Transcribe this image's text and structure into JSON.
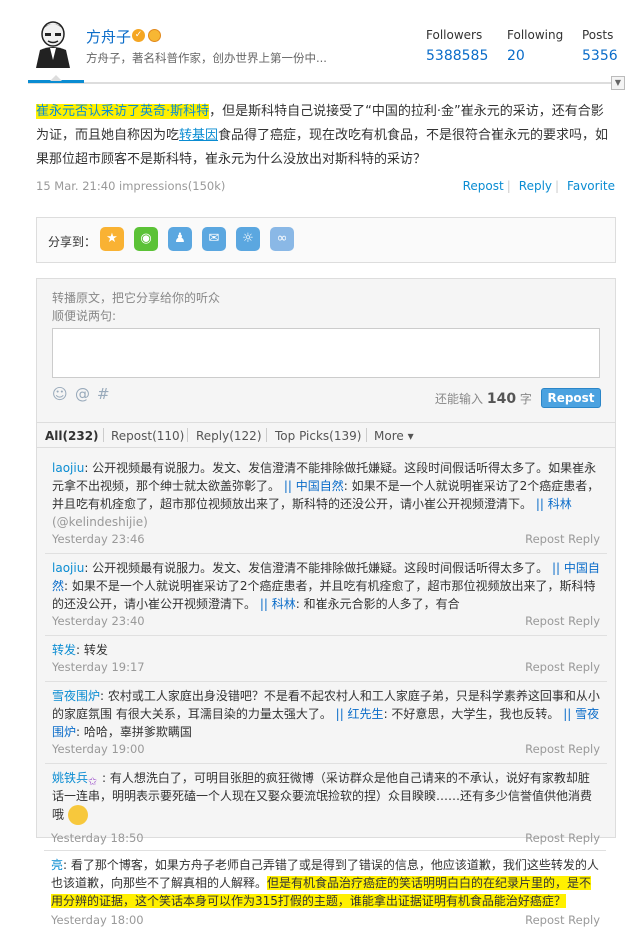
{
  "header": {
    "username": "方舟子",
    "bio": "方舟子，著名科普作家，创办世界上第一份中...",
    "followers_label": "Followers",
    "followers_value": "5388585",
    "following_label": "Following",
    "following_value": "20",
    "posts_label": "Posts",
    "posts_value": "5356"
  },
  "post": {
    "part1": "崔永元否认采访了英奇·斯科特",
    "part2": "，但是斯科特自己说接受了“中国的拉利·金”崔永元的采访，还有合影为证，而且她自称因为吃",
    "link": "转基因",
    "part3": "食品得了癌症，现在改吃有机食品，不是很符合崔永元的要求吗，如果那位超市顾客不是斯科特，崔永元为什么没放出对斯科特的采访？",
    "meta": "15 Mar. 21:40 impressions(150k)",
    "repost": "Repost",
    "reply": "Reply",
    "favorite": "Favorite"
  },
  "share": {
    "label": "分享到："
  },
  "repost_box": {
    "hint1": "转播原文，把它分享给你的听众",
    "hint2": "顺便说两句:",
    "count_prefix": "还能输入",
    "count_value": "140",
    "count_suffix": "字",
    "button": "Repost"
  },
  "tabs": {
    "all": "All(232)",
    "repost": "Repost(110)",
    "reply": "Reply(122)",
    "top": "Top Picks(139)",
    "more": "More"
  },
  "comments": [
    {
      "t1": "laojiu",
      "t2": ": 公开视频最有说服力。发文、发信澄清不能排除做托嫌疑。这段时间假话听得太多了。如果崔永元拿不出视频，那个绅士就太欲盖弥彰了。",
      "t3": "|| 中国自然",
      "t4": ": 如果不是一个人就说明崔采访了2个癌症患者，并且吃有机痊愈了，超市那位视频放出来了，斯科特的还没公开，请小崔公开视频澄清下。",
      "t5": "|| 科林",
      "t6": "(@kelindeshijie)",
      "time": "Yesterday 23:46",
      "action": "Repost Reply"
    },
    {
      "t1": "laojiu",
      "t2": ": 公开视频最有说服力。发文、发信澄清不能排除做托嫌疑。这段时间假话听得太多了。",
      "t3": "|| 中国自然",
      "t4": ": 如果不是一个人就说明崔采访了2个癌症患者，并且吃有机痊愈了，超市那位视频放出来了，斯科特的还没公开，请小崔公开视频澄清下。",
      "t5": "|| 科林",
      "t6": ": 和崔永元合影的人多了，有合",
      "time": "Yesterday 23:40",
      "action": "Repost Reply"
    },
    {
      "t1": "转发",
      "t2": ": 转发",
      "time": "Yesterday 19:17",
      "action": "Repost Reply"
    },
    {
      "t1": "雪夜围炉",
      "t2": ": 农村或工人家庭出身没错吧？不是看不起农村人和工人家庭子弟，只是科学素养这回事和从小的家庭氛围 有很大关系，耳濡目染的力量太强大了。",
      "t3": "|| 红先生",
      "t4": ": 不好意思，大学生，我也反转。",
      "t5": "|| 雪夜围炉",
      "t6": ": 哈哈，辜拼爹欺瞒国",
      "time": "Yesterday 19:00",
      "action": "Repost Reply"
    },
    {
      "t1": "姚铁兵",
      "t2": ": 有人想洗白了，可明目张胆的疯狂微博（采访群众是他自己请来的不承认，说好有家教却脏话一连串，明明表示要死磕一个人现在又娶众要流氓捡软的捏）众目睽睽……还有多少信誉值供他消费哦",
      "time": "Yesterday 18:50",
      "action": "Repost Reply"
    },
    {
      "t1": "亮",
      "t2": ": 看了那个博客，如果方舟子老师自己弄错了或是得到了错误的信息，他应该道歉，我们这些转发的人也该道歉，向那些不了解真相的人解释。",
      "t3": "但是有机食品治疗癌症的笑话明明白白的在纪录片里的，是不用分辨的证据，这个笑话本身可以作为315打假的主题，谁能拿出证据证明有机食品能治好癌症？",
      "time": "Yesterday 18:00",
      "action": "Repost Reply"
    }
  ]
}
